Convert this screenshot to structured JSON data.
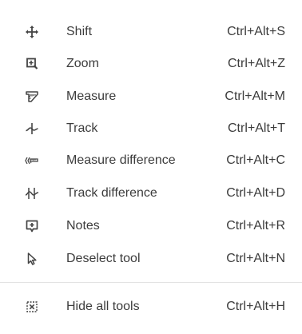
{
  "menu": {
    "items": [
      {
        "icon": "move-arrows-icon",
        "label": "Shift",
        "shortcut": "Ctrl+Alt+S"
      },
      {
        "icon": "zoom-in-icon",
        "label": "Zoom",
        "shortcut": "Ctrl+Alt+Z"
      },
      {
        "icon": "ruler-icon",
        "label": "Measure",
        "shortcut": "Ctrl+Alt+M"
      },
      {
        "icon": "track-icon",
        "label": "Track",
        "shortcut": "Ctrl+Alt+T"
      },
      {
        "icon": "measure-difference-icon",
        "label": "Measure difference",
        "shortcut": "Ctrl+Alt+C"
      },
      {
        "icon": "track-difference-icon",
        "label": "Track difference",
        "shortcut": "Ctrl+Alt+D"
      },
      {
        "icon": "note-icon",
        "label": "Notes",
        "shortcut": "Ctrl+Alt+R"
      },
      {
        "icon": "cursor-icon",
        "label": "Deselect tool",
        "shortcut": "Ctrl+Alt+N"
      }
    ],
    "footer_item": {
      "icon": "hide-tools-icon",
      "label": "Hide all tools",
      "shortcut": "Ctrl+Alt+H"
    }
  }
}
